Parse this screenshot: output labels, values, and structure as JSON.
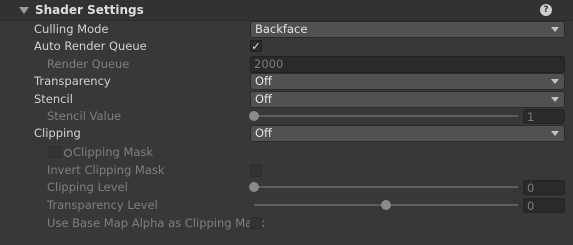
{
  "header": {
    "title": "Shader Settings",
    "help_icon": "help-icon"
  },
  "rows": {
    "culling_mode": {
      "label": "Culling Mode",
      "value": "Backface"
    },
    "auto_render_queue": {
      "label": "Auto Render Queue",
      "checked": true
    },
    "render_queue": {
      "label": "Render Queue",
      "value": "2000"
    },
    "transparency": {
      "label": "Transparency",
      "value": "Off"
    },
    "stencil": {
      "label": "Stencil",
      "value": "Off"
    },
    "stencil_value": {
      "label": "Stencil Value",
      "value": "1",
      "fraction": 0.0
    },
    "clipping": {
      "label": "Clipping",
      "value": "Off"
    },
    "clipping_mask": {
      "label": "Clipping Mask"
    },
    "invert_clipping_mask": {
      "label": "Invert Clipping Mask",
      "checked": false
    },
    "clipping_level": {
      "label": "Clipping Level",
      "value": "0",
      "fraction": 0.0
    },
    "transparency_level": {
      "label": "Transparency Level",
      "value": "0",
      "fraction": 0.5
    },
    "use_base_map_alpha": {
      "label": "Use Base Map Alpha as Clipping Mask",
      "checked": false
    }
  },
  "colors": {
    "background": "#383838",
    "header_background": "#323232",
    "text": "#d2d2d2",
    "disabled_text": "#7f7f7f"
  }
}
